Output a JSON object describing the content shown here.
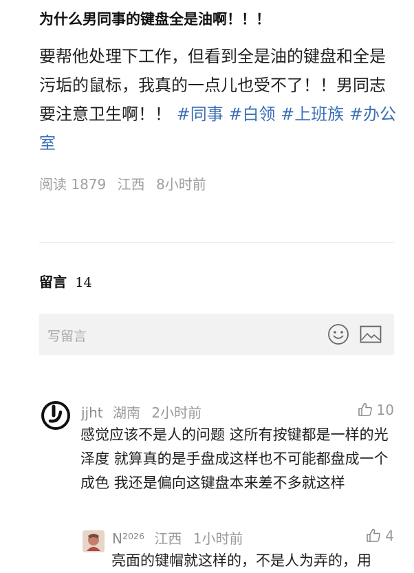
{
  "post": {
    "title": "为什么男同事的键盘全是油啊！！！",
    "body": "要帮他处理下工作，但看到全是油的键盘和全是污垢的鼠标，我真的一点儿也受不了！！男同志要注意卫生啊！！",
    "hashtags": [
      "#同事",
      "#白领",
      "#上班族",
      "#办公室"
    ],
    "meta": {
      "reads": "阅读 1879",
      "location": "江西",
      "time": "8小时前"
    }
  },
  "comments_section": {
    "label": "留言",
    "count": "14",
    "input_placeholder": "写留言",
    "emoji_icon": "smiley-icon",
    "image_icon": "image-icon"
  },
  "comments": [
    {
      "user": "jjht",
      "location": "湖南",
      "time": "2小时前",
      "likes": "10",
      "text": "感觉应该不是人的问题  这所有按键都是一样的光泽度  就算真的是手盘成这样也不可能都盘成一个成色  我还是偏向这键盘本来差不多就这样",
      "avatar_icon": "avatar-icon"
    },
    {
      "user": "N²⁰²⁶",
      "location": "江西",
      "time": "1小时前",
      "likes": "4",
      "text": "亮面的键帽就这样的，不是人为弄的，用",
      "avatar_icon": "avatar-icon"
    }
  ],
  "colors": {
    "hashtag": "#3b6fb6",
    "meta": "#a0a0a0",
    "input_bg": "#f2f2f2"
  }
}
